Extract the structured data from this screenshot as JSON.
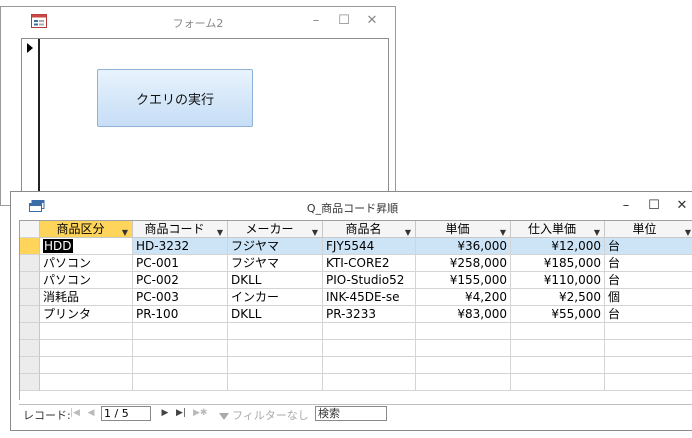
{
  "form_window": {
    "title": "フォーム2",
    "query_button_label": "クエリの実行",
    "buttons": {
      "minimize": "–",
      "maximize": "☐",
      "close": "✕"
    }
  },
  "query_window": {
    "title": "Q_商品コード昇順",
    "buttons": {
      "minimize": "–",
      "maximize": "☐",
      "close": "✕"
    },
    "columns": [
      "商品区分",
      "商品コード",
      "メーカー",
      "商品名",
      "単価",
      "仕入単価",
      "単位"
    ],
    "rows": [
      [
        "HDD",
        "HD-3232",
        "フジヤマ",
        "FJY5544",
        "¥36,000",
        "¥12,000",
        "台"
      ],
      [
        "パソコン",
        "PC-001",
        "フジヤマ",
        "KTI-CORE2",
        "¥258,000",
        "¥185,000",
        "台"
      ],
      [
        "パソコン",
        "PC-002",
        "DKLL",
        "PIO-Studio52",
        "¥155,000",
        "¥110,000",
        "台"
      ],
      [
        "消耗品",
        "PC-003",
        "インカー",
        "INK-45DE-se",
        "¥4,200",
        "¥2,500",
        "個"
      ],
      [
        "プリンタ",
        "PR-100",
        "DKLL",
        "PR-3233",
        "¥83,000",
        "¥55,000",
        "台"
      ]
    ],
    "sort_column": "商品区分",
    "current_row": 0
  },
  "navigation": {
    "label": "レコード:",
    "position": "1 / 5",
    "filter_label": "フィルターなし",
    "search_value": "検索",
    "icons": [
      "first-record-icon",
      "prev-record-icon",
      "next-record-icon",
      "last-record-icon",
      "new-record-icon",
      "filter-icon"
    ]
  },
  "colors": {
    "header_active": "#ffd45a",
    "selected_row": "#cde4f7",
    "button_border": "#8fb3d6"
  }
}
